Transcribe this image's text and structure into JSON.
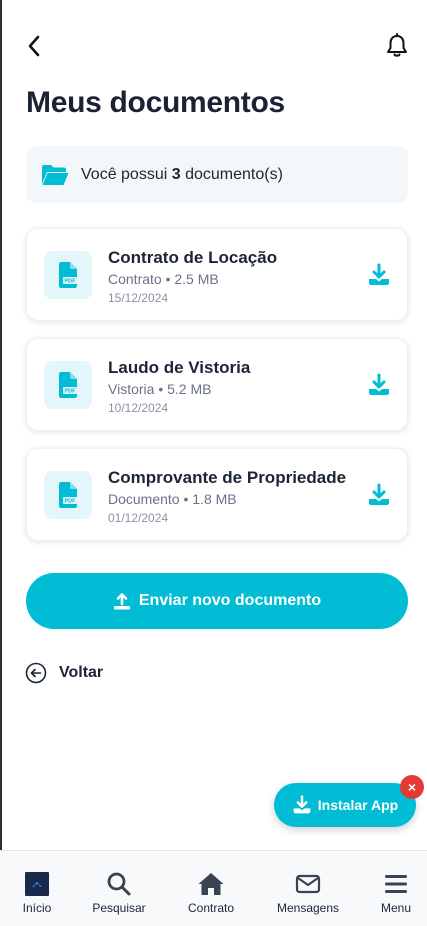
{
  "header": {
    "title": "Meus documentos"
  },
  "summary": {
    "prefix": "Você possui ",
    "count": "3",
    "suffix": " documento(s)"
  },
  "documents": [
    {
      "name": "Contrato de Locação",
      "type": "Contrato",
      "size": "2.5 MB",
      "meta": "Contrato • 2.5 MB",
      "date": "15/12/2024",
      "badge": "PDF"
    },
    {
      "name": "Laudo de Vistoria",
      "type": "Vistoria",
      "size": "5.2 MB",
      "meta": "Vistoria • 5.2 MB",
      "date": "10/12/2024",
      "badge": "PDF"
    },
    {
      "name": "Comprovante de Propriedade",
      "type": "Documento",
      "size": "1.8 MB",
      "meta": "Documento • 1.8 MB",
      "date": "01/12/2024",
      "badge": "PDF"
    }
  ],
  "actions": {
    "upload_label": "Enviar novo documento",
    "back_label": "Voltar",
    "install_label": "Instalar App",
    "install_close": "×"
  },
  "nav": {
    "items": [
      {
        "label": "Início",
        "icon": "home-logo-icon"
      },
      {
        "label": "Pesquisar",
        "icon": "search-icon"
      },
      {
        "label": "Contrato",
        "icon": "house-icon"
      },
      {
        "label": "Mensagens",
        "icon": "mail-icon"
      },
      {
        "label": "Menu",
        "icon": "menu-icon"
      }
    ]
  },
  "colors": {
    "accent": "#00bcd4",
    "text": "#1c2536",
    "close": "#e53935"
  }
}
